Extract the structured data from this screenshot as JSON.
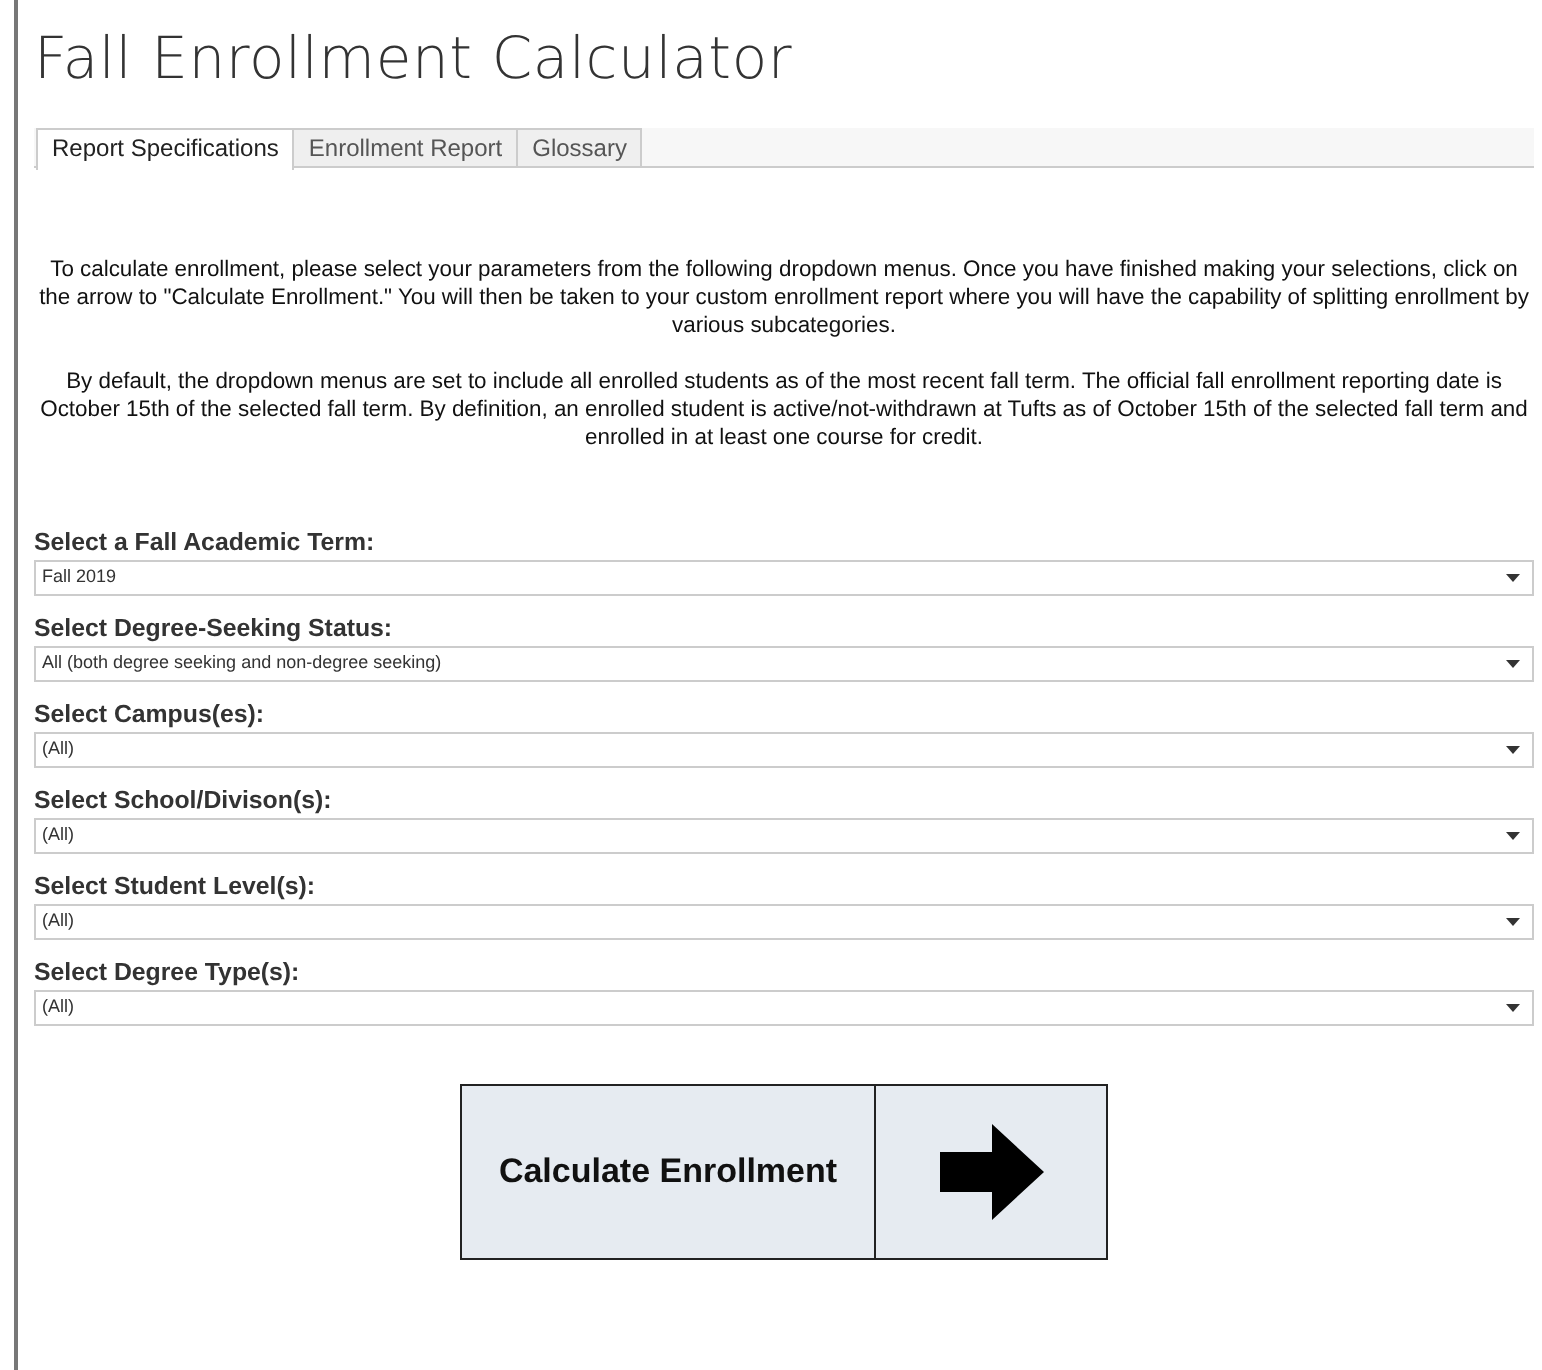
{
  "title": "Fall Enrollment Calculator",
  "tabs": [
    {
      "label": "Report Specifications",
      "selected": true
    },
    {
      "label": "Enrollment Report",
      "selected": false
    },
    {
      "label": "Glossary",
      "selected": false
    }
  ],
  "intro": [
    "To calculate enrollment, please select your parameters from the following dropdown menus. Once you have finished making your selections, click on the arrow to \"Calculate Enrollment.\" You will then be taken to your custom enrollment report where you will have the capability of splitting enrollment by various subcategories.",
    "By default, the dropdown menus are set to include all enrolled students as of the most recent fall term. The official fall enrollment reporting date is October 15th of the selected fall term. By definition, an enrolled student is active/not-withdrawn at Tufts as of October 15th of the selected fall term and enrolled in at least one course for credit."
  ],
  "filters": [
    {
      "label": "Select a Fall Academic Term:",
      "value": "Fall 2019"
    },
    {
      "label": "Select Degree-Seeking Status:",
      "value": "All (both degree seeking and non-degree seeking)"
    },
    {
      "label": "Select Campus(es):",
      "value": "(All)"
    },
    {
      "label": "Select School/Divison(s):",
      "value": "(All)"
    },
    {
      "label": "Select Student Level(s):",
      "value": "(All)"
    },
    {
      "label": "Select Degree Type(s):",
      "value": "(All)"
    }
  ],
  "calculate_button": {
    "label": "Calculate Enrollment"
  }
}
